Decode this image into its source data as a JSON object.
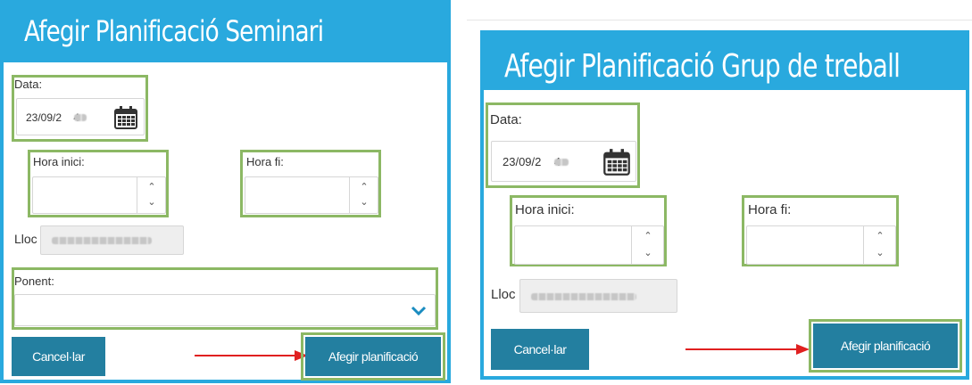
{
  "seminari": {
    "title": "Afegir Planificació Seminari",
    "date_label": "Data:",
    "date_value": "23/09/2    4",
    "start_label": "Hora inici:",
    "end_label": "Hora fi:",
    "place_label": "Lloc",
    "speaker_label": "Ponent:",
    "cancel_label": "Cancel·lar",
    "submit_label": "Afegir planificació"
  },
  "grup_treball": {
    "title": "Afegir Planificació Grup de treball",
    "date_label": "Data:",
    "date_value": "23/09/2    4",
    "start_label": "Hora inici:",
    "end_label": "Hora fi:",
    "place_label": "Lloc",
    "cancel_label": "Cancel·lar",
    "submit_label": "Afegir planificació"
  },
  "icons": {
    "calendar": "calendar-icon",
    "spinner_up": "chevron-up-icon",
    "spinner_down": "chevron-down-icon",
    "dropdown": "chevron-down-icon",
    "annotation": "red-arrow-icon"
  },
  "colors": {
    "title_bar": "#29a9de",
    "button": "#237fa0",
    "highlight": "#8cb864",
    "arrow": "#e02020"
  }
}
